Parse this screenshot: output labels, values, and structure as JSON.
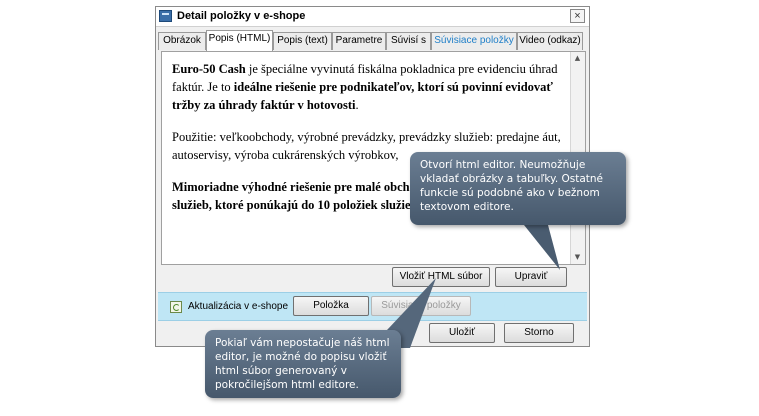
{
  "window": {
    "title": "Detail položky v e-shope",
    "close_glyph": "×"
  },
  "tabs": [
    {
      "label": "Obrázok",
      "active": false
    },
    {
      "label": "Popis (HTML)",
      "active": true
    },
    {
      "label": "Popis (text)",
      "active": false
    },
    {
      "label": "Parametre",
      "active": false
    },
    {
      "label": "Súvisí s",
      "active": false
    },
    {
      "label": "Súvisiace položky",
      "active": false,
      "color": "#1f7fc8"
    },
    {
      "label": "Video (odkaz)",
      "active": false
    }
  ],
  "editor": {
    "p1_bold1": "Euro-50 Cash",
    "p1_text1": " je špeciálne vyvinutá fiskálna pokladnica pre evidenciu úhrad faktúr. Je to ",
    "p1_bold2": "ideálne riešenie pre podnikateľov, ktorí sú povinní evidovať tržby za úhrady faktúr v hotovosti",
    "p1_text2": ".",
    "p2": "Použitie: veľkoobchody, výrobné prevádzky, prevádzky služieb: predajne áut, autoservisy, výroba cukrárenských výrobkov,",
    "p3_bold": "Mimoriadne výhodné riešenie pre malé obchodné prevádzky, prevádzky služieb, ktoré ponúkajú do 10 položiek služieb."
  },
  "buttons": {
    "insert_html": "Vložiť HTML súbor",
    "edit": "Upraviť",
    "item": "Položka",
    "related_items": "Súvisiace položky",
    "save": "Uložiť",
    "cancel": "Storno"
  },
  "strip": {
    "label": "Aktualizácia v e-shope"
  },
  "callouts": {
    "editor_hint": "Otvorí html editor. Neumožňuje vkladať obrázky a tabuľky. Ostatné funkcie sú podobné ako v bežnom textovom editore.",
    "insert_hint": "Pokiaľ vám nepostačuje náš html editor, je možné do popisu vložiť html súbor generovaný v pokročilejšom html editore."
  },
  "colors": {
    "strip": "#bfe6f5",
    "callout": "#55677b",
    "link_tab": "#1f7fc8"
  }
}
